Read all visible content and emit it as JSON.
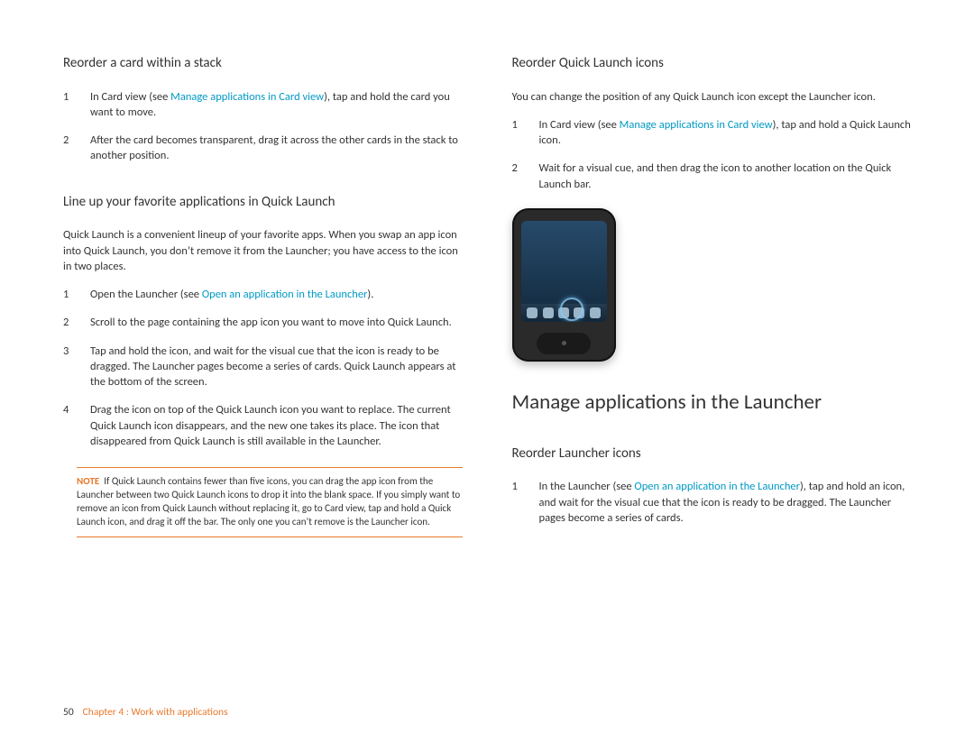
{
  "left": {
    "sec1": {
      "heading": "Reorder a card within a stack",
      "steps": [
        {
          "num": "1",
          "pre": "In Card view (see ",
          "link": "Manage applications in Card view",
          "post": "), tap and hold the card you want to move."
        },
        {
          "num": "2",
          "pre": "After the card becomes transparent, drag it across the other cards in the stack to another position.",
          "link": "",
          "post": ""
        }
      ]
    },
    "sec2": {
      "heading": "Line up your favorite applications in Quick Launch",
      "intro": "Quick Launch is a convenient lineup of your favorite apps. When you swap an app icon into Quick Launch, you don’t remove it from the Launcher; you have access to the icon in two places.",
      "steps": [
        {
          "num": "1",
          "pre": "Open the Launcher (see ",
          "link": "Open an application in the Launcher",
          "post": ")."
        },
        {
          "num": "2",
          "pre": "Scroll to the page containing the app icon you want to move into Quick Launch.",
          "link": "",
          "post": ""
        },
        {
          "num": "3",
          "pre": "Tap and hold the icon, and wait for the visual cue that the icon is ready to be dragged. The Launcher pages become a series of cards. Quick Launch appears at the bottom of the screen.",
          "link": "",
          "post": ""
        },
        {
          "num": "4",
          "pre": "Drag the icon on top of the Quick Launch icon you want to replace. The current Quick Launch icon disappears, and the new one takes its place. The icon that disappeared from Quick Launch is still available in the Launcher.",
          "link": "",
          "post": ""
        }
      ],
      "note": {
        "label": "NOTE",
        "text": "If Quick Launch contains fewer than five icons, you can drag the app icon from the Launcher between two Quick Launch icons to drop it into the blank space. If you simply want to remove an icon from Quick Launch without replacing it, go to Card view, tap and hold a Quick Launch icon, and drag it off the bar. The only one you can’t remove is the Launcher icon."
      }
    }
  },
  "right": {
    "sec3": {
      "heading": "Reorder Quick Launch icons",
      "intro": "You can change the position of any Quick Launch icon except the Launcher icon.",
      "steps": [
        {
          "num": "1",
          "pre": "In Card view (see ",
          "link": "Manage applications in Card view",
          "post": "), tap and hold a Quick Launch icon."
        },
        {
          "num": "2",
          "pre": "Wait for a visual cue, and then drag the icon to another location on the Quick Launch bar.",
          "link": "",
          "post": ""
        }
      ]
    },
    "bigHeading": "Manage applications in the Launcher",
    "sec4": {
      "heading": "Reorder Launcher icons",
      "steps": [
        {
          "num": "1",
          "pre": "In the Launcher (see ",
          "link": "Open an application in the Launcher",
          "post": "), tap and hold an icon, and wait for the visual cue that the icon is ready to be dragged. The Launcher pages become a series of cards."
        }
      ]
    }
  },
  "footer": {
    "page": "50",
    "chapter": "Chapter 4 : Work with applications"
  }
}
